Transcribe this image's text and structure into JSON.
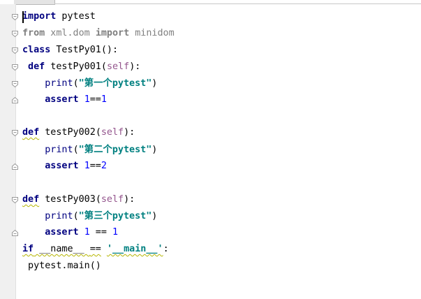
{
  "editor": {
    "lines": [
      {
        "tokens": [
          {
            "t": "import",
            "c": "kw"
          },
          {
            "t": " pytest",
            "c": "id"
          }
        ]
      },
      {
        "tokens": [
          {
            "t": "from",
            "c": "kw dim"
          },
          {
            "t": " xml.dom ",
            "c": "dim"
          },
          {
            "t": "import",
            "c": "kw dim"
          },
          {
            "t": " minidom",
            "c": "dim"
          }
        ]
      },
      {
        "tokens": [
          {
            "t": "class",
            "c": "kw"
          },
          {
            "t": " TestPy01",
            "c": "id"
          },
          {
            "t": "():",
            "c": "id"
          }
        ]
      },
      {
        "tokens": [
          {
            "t": " def",
            "c": "kw"
          },
          {
            "t": " testPy001",
            "c": "id"
          },
          {
            "t": "(",
            "c": "id"
          },
          {
            "t": "self",
            "c": "slf"
          },
          {
            "t": "):",
            "c": "id"
          }
        ]
      },
      {
        "tokens": [
          {
            "t": "    print",
            "c": "fn-call"
          },
          {
            "t": "(",
            "c": "id"
          },
          {
            "t": "\"第一个pytest\"",
            "c": "str"
          },
          {
            "t": ")",
            "c": "id"
          }
        ]
      },
      {
        "tokens": [
          {
            "t": "    assert",
            "c": "kw"
          },
          {
            "t": " ",
            "c": "id"
          },
          {
            "t": "1",
            "c": "num"
          },
          {
            "t": "==",
            "c": "id"
          },
          {
            "t": "1",
            "c": "num"
          }
        ]
      },
      {
        "tokens": []
      },
      {
        "tokens": [
          {
            "t": "def",
            "c": "kw squig"
          },
          {
            "t": " testPy002",
            "c": "id"
          },
          {
            "t": "(",
            "c": "id"
          },
          {
            "t": "self",
            "c": "slf"
          },
          {
            "t": "):",
            "c": "id"
          }
        ]
      },
      {
        "tokens": [
          {
            "t": "    print",
            "c": "fn-call"
          },
          {
            "t": "(",
            "c": "id"
          },
          {
            "t": "\"第二个pytest\"",
            "c": "str"
          },
          {
            "t": ")",
            "c": "id"
          }
        ]
      },
      {
        "tokens": [
          {
            "t": "    assert",
            "c": "kw"
          },
          {
            "t": " ",
            "c": "id"
          },
          {
            "t": "1",
            "c": "num"
          },
          {
            "t": "==",
            "c": "id"
          },
          {
            "t": "2",
            "c": "num"
          }
        ]
      },
      {
        "tokens": []
      },
      {
        "tokens": [
          {
            "t": "def",
            "c": "kw squig"
          },
          {
            "t": " testPy003",
            "c": "id"
          },
          {
            "t": "(",
            "c": "id"
          },
          {
            "t": "self",
            "c": "slf"
          },
          {
            "t": "):",
            "c": "id"
          }
        ]
      },
      {
        "tokens": [
          {
            "t": "    print",
            "c": "fn-call"
          },
          {
            "t": "(",
            "c": "id"
          },
          {
            "t": "\"第三个pytest\"",
            "c": "str"
          },
          {
            "t": ")",
            "c": "id"
          }
        ]
      },
      {
        "tokens": [
          {
            "t": "    assert",
            "c": "kw"
          },
          {
            "t": " ",
            "c": "id"
          },
          {
            "t": "1",
            "c": "num"
          },
          {
            "t": " == ",
            "c": "id"
          },
          {
            "t": "1",
            "c": "num"
          }
        ]
      },
      {
        "tokens": [
          {
            "t": "if",
            "c": "kw squig"
          },
          {
            "t": " __name__ ",
            "c": "id squig"
          },
          {
            "t": "==",
            "c": "id squig"
          },
          {
            "t": " ",
            "c": "id"
          },
          {
            "t": "'__main__'",
            "c": "str squig"
          },
          {
            "t": ":",
            "c": "id"
          }
        ]
      },
      {
        "tokens": [
          {
            "t": " pytest.main()",
            "c": "id"
          }
        ]
      }
    ],
    "fold_markers": [
      "open",
      "open",
      "open",
      "open",
      "open",
      "close",
      "none",
      "open",
      "none",
      "close",
      "none",
      "open",
      "none",
      "close",
      "none",
      "none"
    ]
  }
}
